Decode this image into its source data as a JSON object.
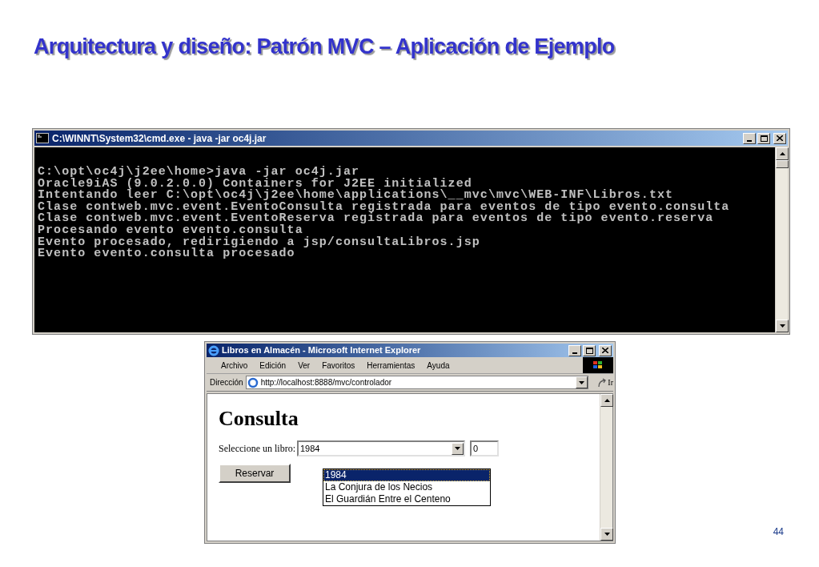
{
  "slide": {
    "title": "Arquitectura y diseño: Patrón MVC – Aplicación de Ejemplo",
    "page_number": "44"
  },
  "console_window": {
    "title": "C:\\WINNT\\System32\\cmd.exe - java -jar oc4j.jar",
    "lines": [
      "C:\\opt\\oc4j\\j2ee\\home>java -jar oc4j.jar",
      "Oracle9iAS (9.0.2.0.0) Containers for J2EE initialized",
      "Intentando leer C:\\opt\\oc4j\\j2ee\\home\\applications\\__mvc\\mvc\\WEB-INF\\Libros.txt",
      "Clase contweb.mvc.event.EventoConsulta registrada para eventos de tipo evento.consulta",
      "Clase contweb.mvc.event.EventoReserva registrada para eventos de tipo evento.reserva",
      "Procesando evento evento.consulta",
      "Evento procesado, redirigiendo a jsp/consultaLibros.jsp",
      "Evento evento.consulta procesado"
    ]
  },
  "browser_window": {
    "title": "Libros en Almacén - Microsoft Internet Explorer",
    "menu": [
      "Archivo",
      "Edición",
      "Ver",
      "Favoritos",
      "Herramientas",
      "Ayuda"
    ],
    "address_label": "Dirección",
    "address": "http://localhost:8888/mvc/controlador",
    "go_label": "Ir",
    "page": {
      "heading": "Consulta",
      "select_label": "Seleccione un libro:",
      "select_value": "1984",
      "options": [
        {
          "label": "1984",
          "selected": true
        },
        {
          "label": "La Conjura de los Necios",
          "selected": false
        },
        {
          "label": "El Guardián Entre el Centeno",
          "selected": false
        }
      ],
      "quantity": "0",
      "button": "Reservar"
    }
  }
}
